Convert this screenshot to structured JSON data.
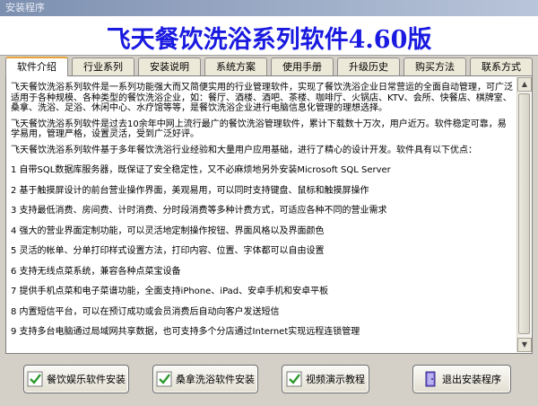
{
  "window": {
    "title": "安装程序"
  },
  "header": {
    "title": "飞天餐饮洗浴系列软件4.60版"
  },
  "tabs": [
    {
      "label": "软件介绍"
    },
    {
      "label": "行业系列"
    },
    {
      "label": "安装说明"
    },
    {
      "label": "系统方案"
    },
    {
      "label": "使用手册"
    },
    {
      "label": "升级历史"
    },
    {
      "label": "购买方法"
    },
    {
      "label": "联系方式"
    }
  ],
  "content": {
    "intro": [
      "飞天餐饮洗浴系列软件是一系列功能强大而又简便实用的行业管理软件，实现了餐饮洗浴企业日常营运的全面自动管理，可广泛适用于各种规模、各种类型的餐饮洗浴企业，如：餐厅、酒楼、酒吧、茶楼、咖啡厅、火锅店、KTV、会所、快餐店、棋牌室、桑拿、洗浴、足浴、休闲中心、水疗馆等等，是餐饮洗浴企业进行电脑信息化管理的理想选择。",
      "飞天餐饮洗浴系列软件是过去10余年中网上流行最广的餐饮洗浴管理软件，累计下载数十万次，用户近万。软件稳定可靠，易学易用，管理严格，设置灵活，受到广泛好评。",
      "飞天餐饮洗浴系列软件基于多年餐饮洗浴行业经验和大量用户应用基础，进行了精心的设计开发。软件具有以下优点："
    ],
    "features": [
      "1 自带SQL数据库服务器，既保证了安全稳定性，又不必麻烦地另外安装Microsoft SQL Server",
      "2 基于触摸屏设计的前台营业操作界面，美观易用，可以同时支持键盘、鼠标和触摸屏操作",
      "3 支持最低消费、房间费、计时消费、分时段消费等多种计费方式，可适应各种不同的营业需求",
      "4 强大的营业界面定制功能，可以灵活地定制操作按钮、界面风格以及界面颜色",
      "5 灵活的帐单、分单打印样式设置方法，打印内容、位置、字体都可以自由设置",
      "6 支持无线点菜系统，兼容各种点菜宝设备",
      "7 提供手机点菜和电子菜谱功能，全面支持iPhone、iPad、安卓手机和安卓平板",
      "8 内置短信平台，可以在预订成功或会员消费后自动向客户发送短信",
      "9 支持多台电脑通过局域网共享数据，也可支持多个分店通过Internet实现远程连锁管理"
    ]
  },
  "buttons": {
    "catering": "餐饮娱乐软件安装",
    "sauna": "桑拿洗浴软件安装",
    "video": "视频演示教程",
    "exit": "退出安装程序"
  },
  "colors": {
    "title_blue": "#1a1ae0",
    "active_tab_accent": "#e8a33a",
    "check_green": "#2e9a2e"
  },
  "icons": {
    "check": "check-icon",
    "exit": "exit-door-icon"
  }
}
